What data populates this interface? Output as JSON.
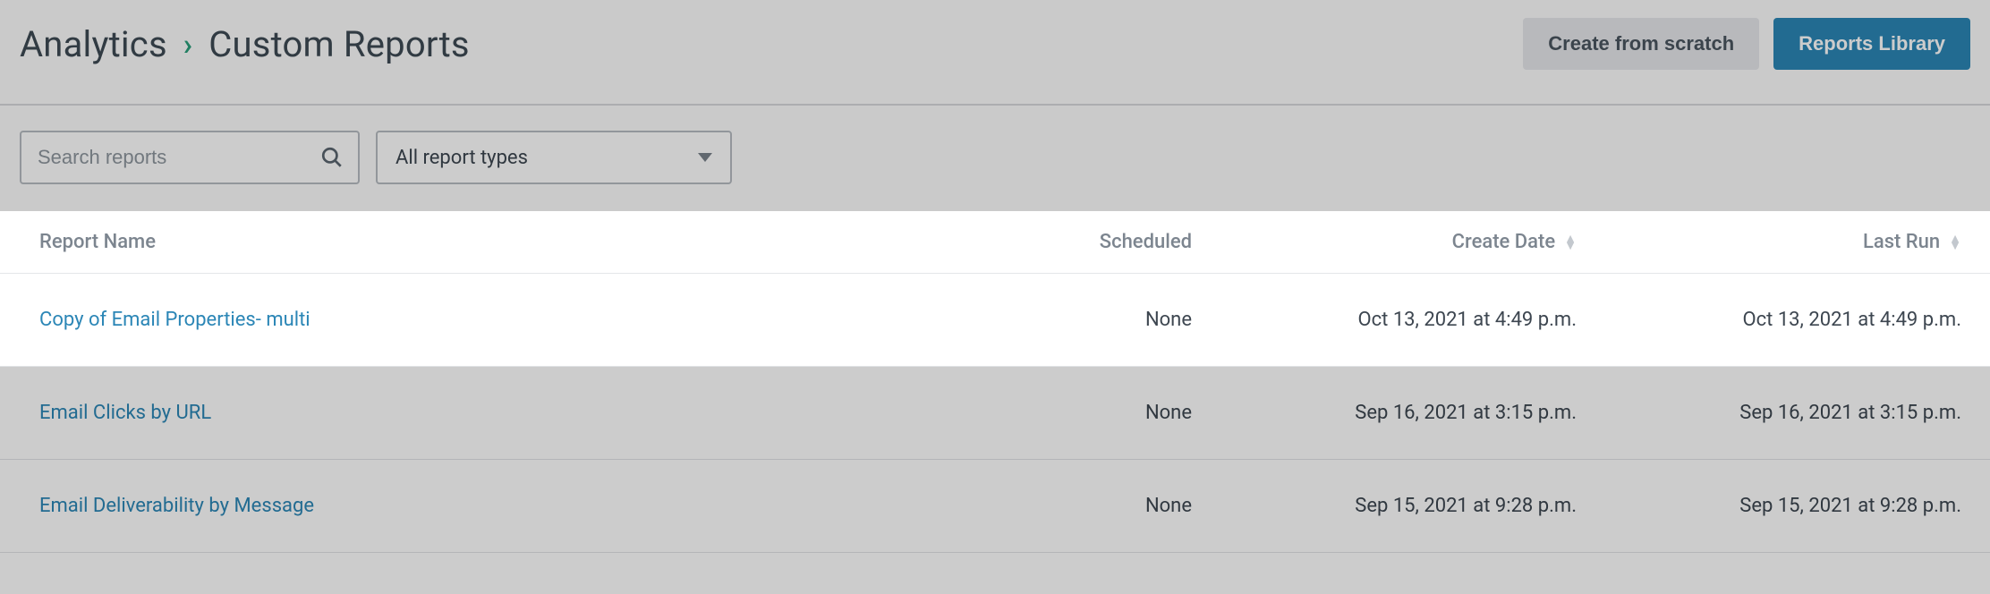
{
  "breadcrumb": {
    "root": "Analytics",
    "current": "Custom Reports"
  },
  "header": {
    "create_from_scratch": "Create from scratch",
    "reports_library": "Reports Library"
  },
  "toolbar": {
    "search_placeholder": "Search reports",
    "report_type_label": "All report types"
  },
  "table": {
    "headers": {
      "name": "Report Name",
      "scheduled": "Scheduled",
      "create_date": "Create Date",
      "last_run": "Last Run"
    },
    "rows": [
      {
        "name": "Copy of Email Properties- multi",
        "scheduled": "None",
        "create_date": "Oct 13, 2021 at 4:49 p.m.",
        "last_run": "Oct 13, 2021 at 4:49 p.m.",
        "highlight": true
      },
      {
        "name": "Email Clicks by URL",
        "scheduled": "None",
        "create_date": "Sep 16, 2021 at 3:15 p.m.",
        "last_run": "Sep 16, 2021 at 3:15 p.m.",
        "highlight": false
      },
      {
        "name": "Email Deliverability by Message",
        "scheduled": "None",
        "create_date": "Sep 15, 2021 at 9:28 p.m.",
        "last_run": "Sep 15, 2021 at 9:28 p.m.",
        "highlight": false
      }
    ]
  }
}
